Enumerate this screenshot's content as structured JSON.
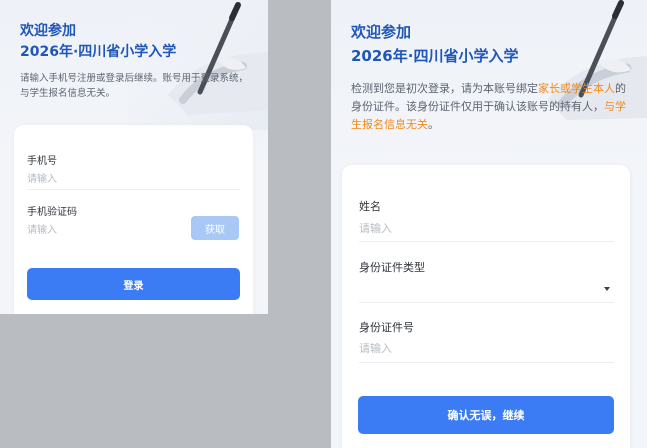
{
  "left_screen": {
    "title_line1": "欢迎参加",
    "title_line2": "2026年·四川省小学入学",
    "description": "请输入手机号注册或登录后继续。账号用于登录系统，与学生报名信息无关。",
    "phone_label": "手机号",
    "phone_placeholder": "请输入",
    "code_label": "手机验证码",
    "code_placeholder": "请输入",
    "get_code_button": "获取",
    "login_button": "登录"
  },
  "right_screen": {
    "title_line1": "欢迎参加",
    "title_line2": "2026年·四川省小学入学",
    "desc_part1": "检测到您是初次登录，请为本账号绑定",
    "desc_hl1": "家长或学生本人",
    "desc_part2": "的身份证件。该身份证件仅用于确认该账号的持有人，",
    "desc_hl2": "与学生报名信息无关",
    "desc_part3": "。",
    "name_label": "姓名",
    "name_placeholder": "请输入",
    "id_type_label": "身份证件类型",
    "id_number_label": "身份证件号",
    "id_number_placeholder": "请输入",
    "confirm_button": "确认无误，继续"
  },
  "colors": {
    "title": "#1f56b8",
    "highlight": "#f08a1a",
    "primary_button": "#3b7cf4",
    "code_button": "#a9c8f6"
  }
}
